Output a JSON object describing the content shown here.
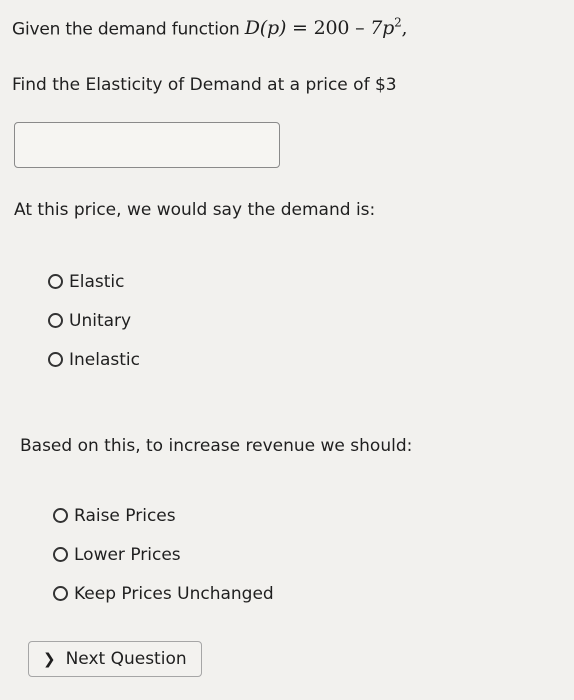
{
  "question1": {
    "prefix": "Given the demand function",
    "function_lhs": "D(p)",
    "function_rhs_const": "200",
    "function_rhs_coef": "7p",
    "exponent": "2",
    "suffix": ","
  },
  "question2": "Find the Elasticity of Demand at a price of $3",
  "answer_input": {
    "value": ""
  },
  "question3": "At this price, we would say the demand is:",
  "demand_options": [
    "Elastic",
    "Unitary",
    "Inelastic"
  ],
  "question4": "Based on this, to increase revenue we should:",
  "revenue_options": [
    "Raise Prices",
    "Lower Prices",
    "Keep Prices Unchanged"
  ],
  "next_button": {
    "icon": "chevron-right-icon",
    "label": "Next Question"
  }
}
